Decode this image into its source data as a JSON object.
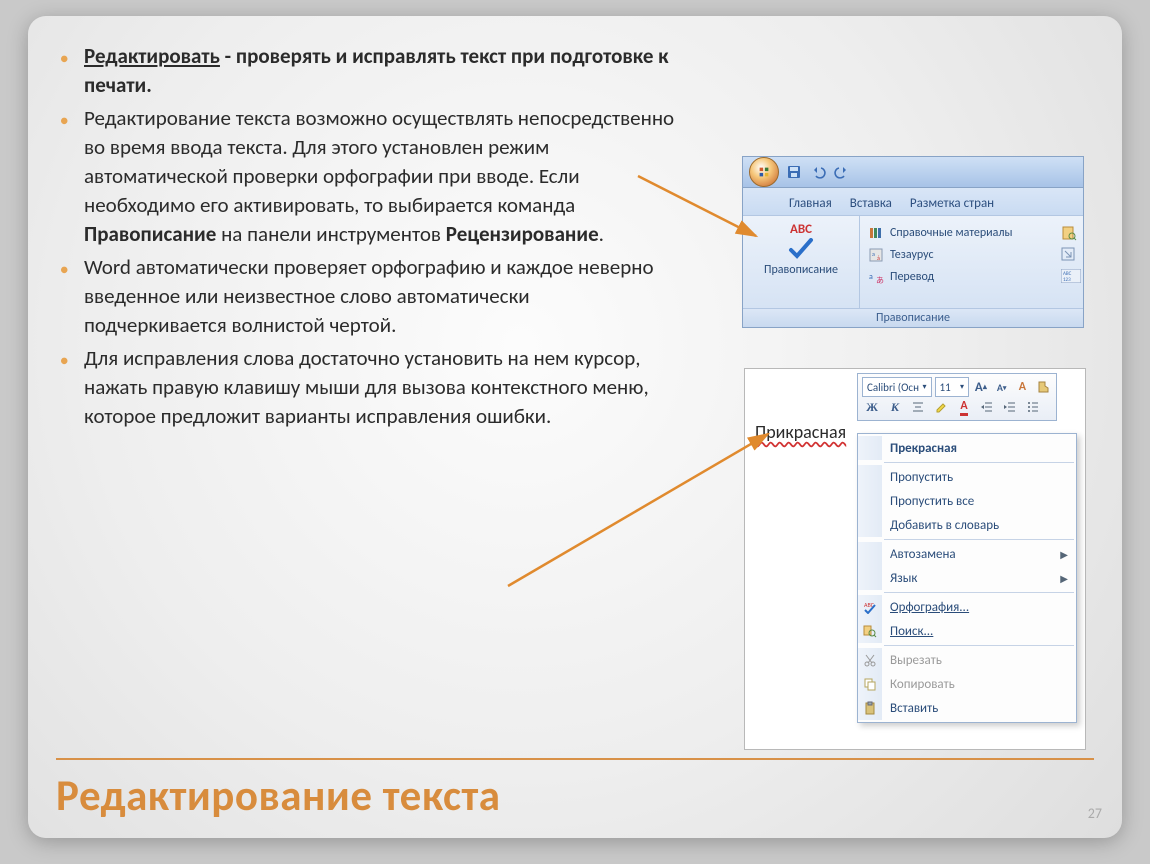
{
  "bullets": {
    "b1_lead": "Редактировать",
    "b1_rest": " - проверять и исправлять текст при подготовке к печати.",
    "b2_pre": "Редактирование текста возможно осуществлять непосредственно во время ввода текста. Для этого установлен режим автоматической проверки орфографии при вводе. Если необходимо его активировать, то выбирается команда ",
    "b2_bold1": "Правописание",
    "b2_mid": " на панели инструментов ",
    "b2_bold2": "Рецензирование",
    "b2_end": ".",
    "b3": "Word автоматически проверяет орфографию и каждое неверно введенное или неизвестное слово автоматически подчеркивается волнистой чертой.",
    "b4": "Для исправления слова достаточно установить на нем курсор, нажать правую клавишу мыши для вызова контекстного меню, которое предложит варианты исправления ошибки."
  },
  "title": "Редактирование текста",
  "page": "27",
  "ribbon": {
    "tabs": {
      "home": "Главная",
      "insert": "Вставка",
      "layout": "Разметка стран"
    },
    "abc_label": "ABC",
    "spelling": "Правописание",
    "ref": "Справочные материалы",
    "thesaurus": "Тезаурус",
    "translate": "Перевод",
    "group_footer": "Правописание"
  },
  "doc": {
    "font_name": "Calibri (Осн",
    "font_size": "11",
    "misspelled": "Прикрасная"
  },
  "menu": {
    "suggestion": "Прекрасная",
    "skip": "Пропустить",
    "skip_all": "Пропустить все",
    "add_dict": "Добавить в словарь",
    "autocorrect": "Автозамена",
    "language": "Язык",
    "spelling": "Орфография...",
    "find": "Поиск...",
    "cut": "Вырезать",
    "copy": "Копировать",
    "paste": "Вставить"
  }
}
